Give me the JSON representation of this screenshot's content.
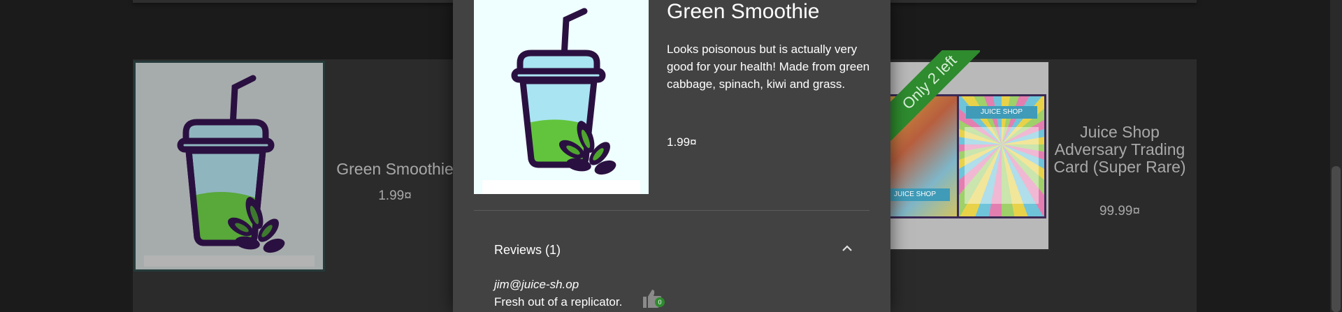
{
  "background": {
    "products": [
      {
        "name": "Green Smoothie",
        "price": "1.99¤"
      },
      {
        "name": "Juice Shop Adversary Trading Card (Super Rare)",
        "price": "99.99¤"
      }
    ],
    "ribbon_text": "Only 2 left",
    "card_texts": {
      "card_left_footer": "JUICE SHOP",
      "card_right_header": "JUICE SHOP"
    }
  },
  "dialog": {
    "title": "Green Smoothie",
    "description": "Looks poisonous but is actually very good for your health! Made from green cabbage, spinach, kiwi and grass.",
    "price": "1.99¤",
    "reviews": {
      "header": "Reviews (1)",
      "expanded": true,
      "items": [
        {
          "author": "jim@juice-sh.op",
          "text": "Fresh out of a replicator.",
          "likes": "0"
        }
      ]
    }
  },
  "colors": {
    "overlay": "#1b1b1b",
    "dialog": "#424242",
    "accent_green": "#2e8b2e"
  }
}
